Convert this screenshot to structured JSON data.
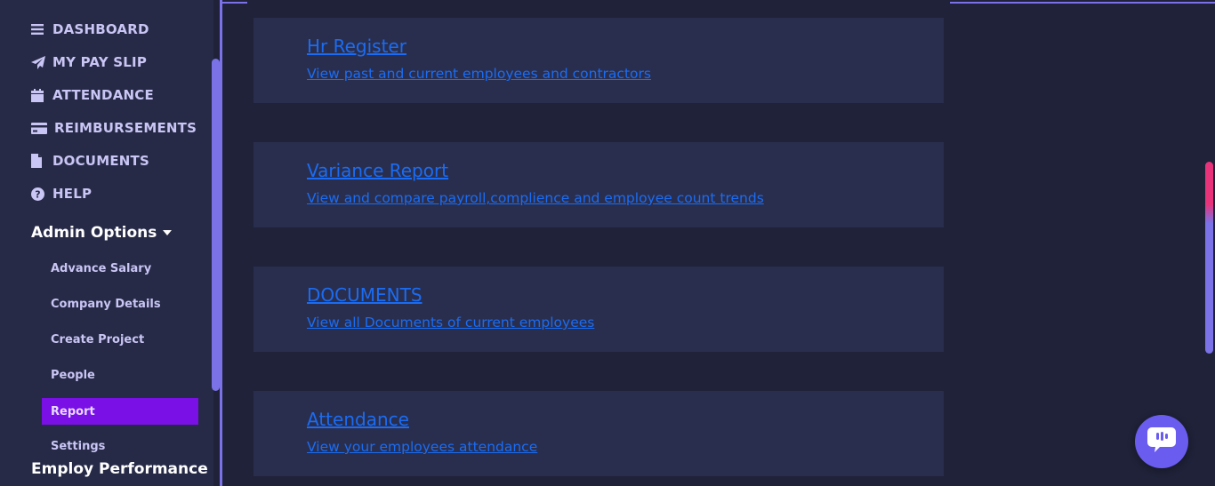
{
  "sidebar": {
    "nav": [
      {
        "label": "DASHBOARD",
        "icon": "menu-icon"
      },
      {
        "label": "MY PAY SLIP",
        "icon": "paper-plane-icon"
      },
      {
        "label": "ATTENDANCE",
        "icon": "calendar-icon"
      },
      {
        "label": "REIMBURSEMENTS",
        "icon": "credit-card-icon"
      },
      {
        "label": "DOCUMENTS",
        "icon": "file-icon"
      },
      {
        "label": "HELP",
        "icon": "question-circle-icon"
      }
    ],
    "admin_title": "Admin Options",
    "admin_items": [
      {
        "label": "Advance Salary"
      },
      {
        "label": "Company Details"
      },
      {
        "label": "Create Project"
      },
      {
        "label": "People"
      },
      {
        "label": "Report",
        "active": true
      },
      {
        "label": "Settings"
      }
    ],
    "performance_title": "Employ Performance"
  },
  "reports": [
    {
      "title": "Hr Register",
      "description": "View past and current employees and contractors"
    },
    {
      "title": "Variance Report",
      "description": "View and compare payroll,complience and employee count trends"
    },
    {
      "title": "DOCUMENTS",
      "description": "View all Documents of current employees"
    },
    {
      "title": "Attendance",
      "description": "View your employees attendance"
    }
  ],
  "colors": {
    "accent": "#7a72e6",
    "active_item": "#7a0fe6",
    "link": "#1b6cf2",
    "card": "#292e4e",
    "background": "#1f2238"
  },
  "chat_widget": {
    "icon": "chat-icon"
  }
}
